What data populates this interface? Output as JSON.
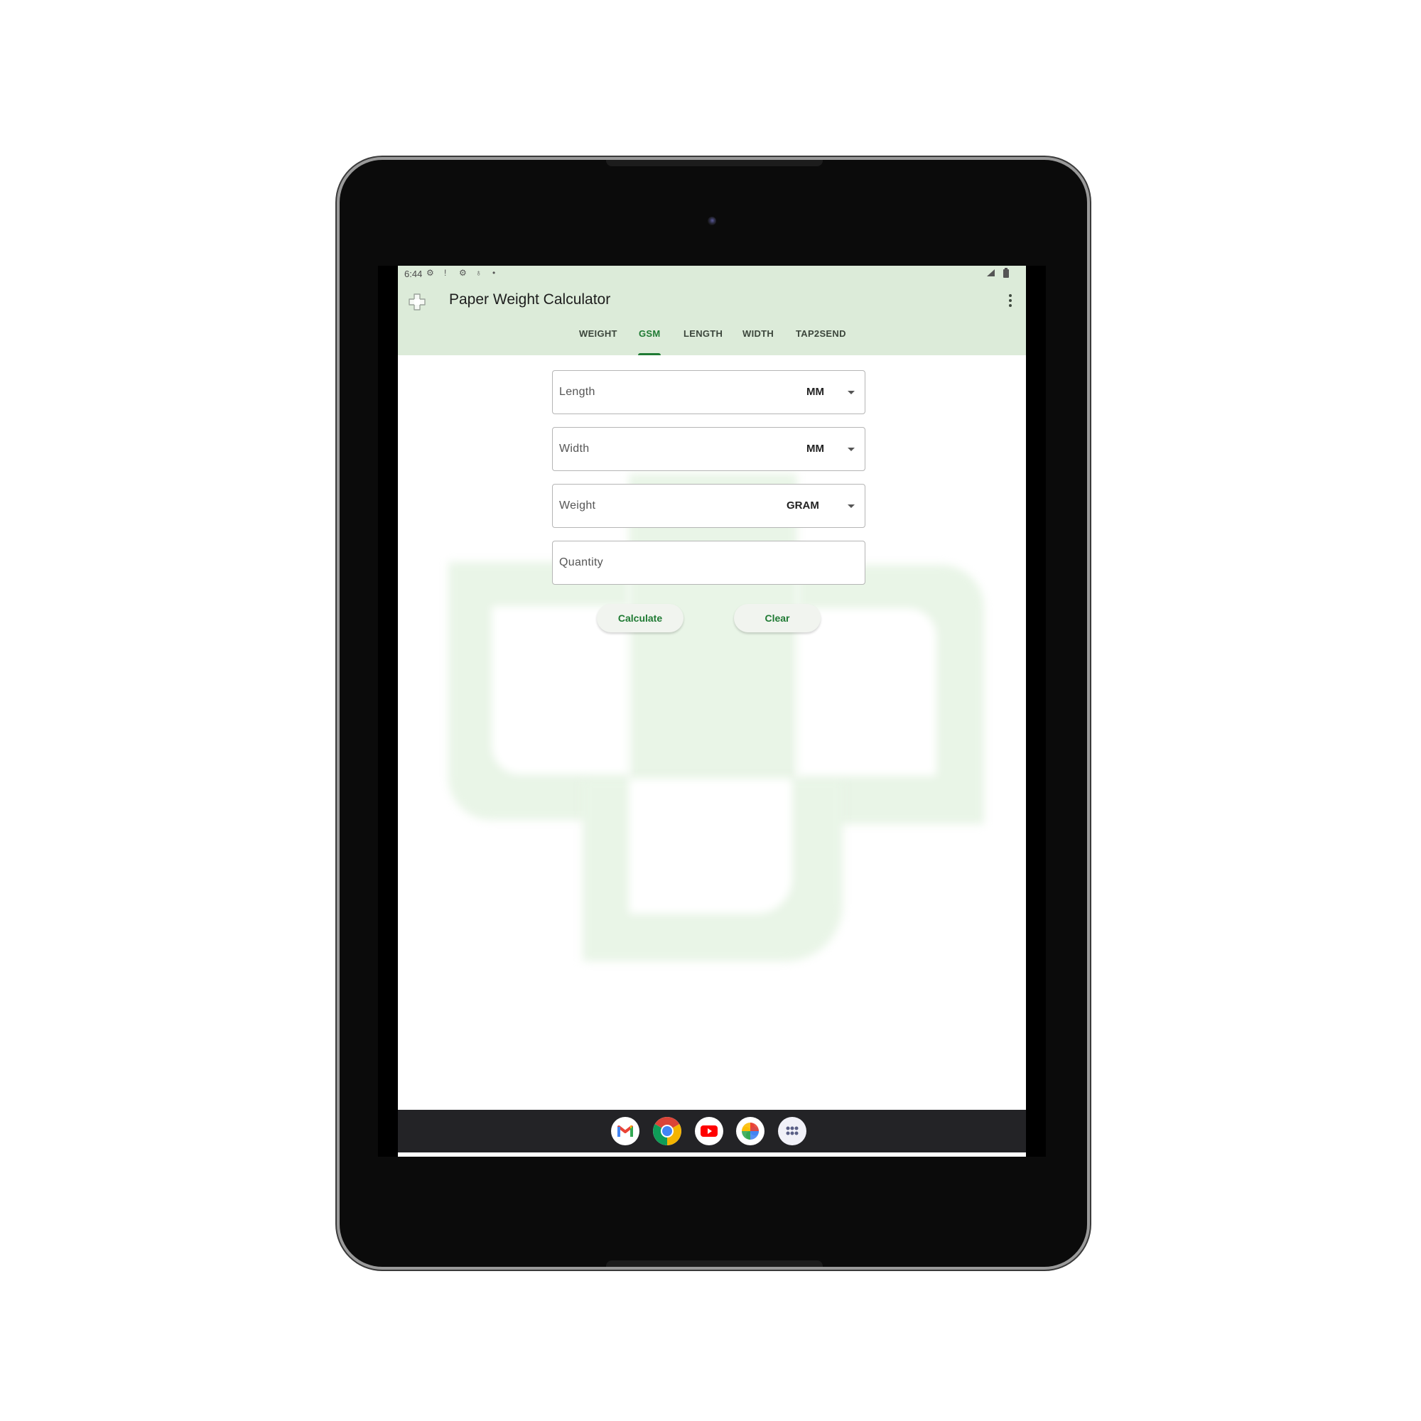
{
  "status_bar": {
    "time": "6:44",
    "left_icons": [
      "settings-gear-icon",
      "alert-icon",
      "network-icon",
      "accessibility-icon",
      "dot-icon"
    ],
    "right_icons": [
      "signal-icon",
      "battery-icon"
    ]
  },
  "app_bar": {
    "title": "Paper Weight Calculator",
    "app_icon": "app-logo-icon",
    "menu_icon": "more-vert-icon"
  },
  "tabs": [
    {
      "label": "WEIGHT",
      "active": false
    },
    {
      "label": "GSM",
      "active": true
    },
    {
      "label": "LENGTH",
      "active": false
    },
    {
      "label": "WIDTH",
      "active": false
    },
    {
      "label": "TAP2SEND",
      "active": false
    }
  ],
  "form": {
    "fields": [
      {
        "label": "Length",
        "value": "",
        "unit": "MM"
      },
      {
        "label": "Width",
        "value": "",
        "unit": "MM"
      },
      {
        "label": "Weight",
        "value": "",
        "unit": "GRAM"
      },
      {
        "label": "Quantity",
        "value": ""
      }
    ],
    "calculate_label": "Calculate",
    "clear_label": "Clear"
  },
  "dock": [
    {
      "name": "Gmail",
      "icon": "gmail-icon"
    },
    {
      "name": "Chrome",
      "icon": "chrome-icon"
    },
    {
      "name": "YouTube",
      "icon": "youtube-icon"
    },
    {
      "name": "Photos",
      "icon": "photos-icon"
    },
    {
      "name": "App drawer",
      "icon": "app-drawer-icon"
    }
  ],
  "colors": {
    "app_bar_bg": "#dcebd9",
    "accent": "#1f7a33",
    "watermark": "#e9f5e7",
    "taskbar": "#232326"
  }
}
